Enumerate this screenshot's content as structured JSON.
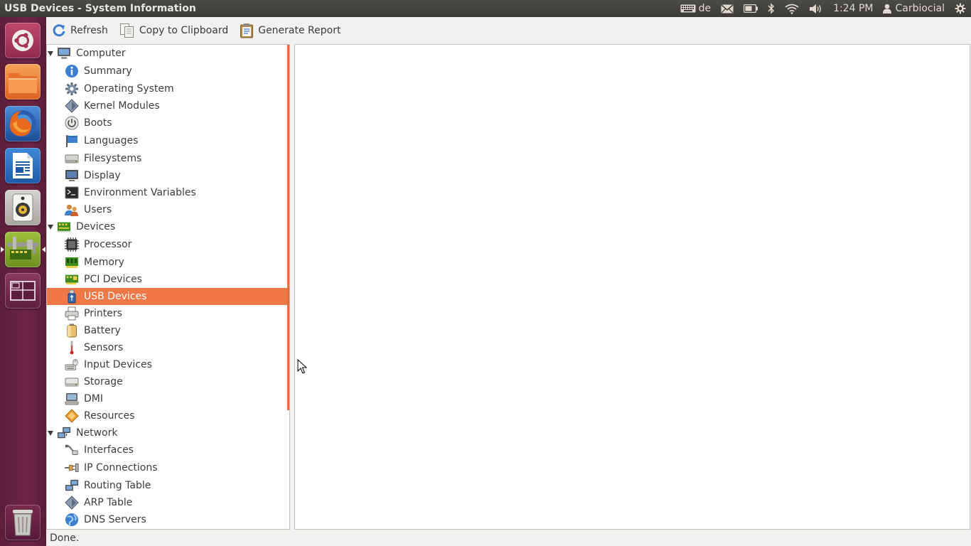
{
  "top_panel": {
    "window_title": "USB Devices - System Information",
    "keyboard_layout": "de",
    "time": "1:24 PM",
    "user": "Carbiocial"
  },
  "launcher": {
    "items": [
      "dash-home",
      "files",
      "firefox",
      "libreoffice-writer",
      "rhythmbox",
      "system-information",
      "workspace-switcher",
      "trash"
    ],
    "active": "system-information"
  },
  "toolbar": {
    "refresh": "Refresh",
    "copy": "Copy to Clipboard",
    "report": "Generate Report"
  },
  "tree": {
    "computer": {
      "label": "Computer",
      "items": [
        "Summary",
        "Operating System",
        "Kernel Modules",
        "Boots",
        "Languages",
        "Filesystems",
        "Display",
        "Environment Variables",
        "Users"
      ]
    },
    "devices": {
      "label": "Devices",
      "items": [
        "Processor",
        "Memory",
        "PCI Devices",
        "USB Devices",
        "Printers",
        "Battery",
        "Sensors",
        "Input Devices",
        "Storage",
        "DMI",
        "Resources"
      ]
    },
    "network": {
      "label": "Network",
      "items": [
        "Interfaces",
        "IP Connections",
        "Routing Table",
        "ARP Table",
        "DNS Servers"
      ]
    },
    "selected": "USB Devices"
  },
  "status": "Done.",
  "colors": {
    "accent": "#f07746",
    "launcher_bg": "#6d2644",
    "panel_bg": "#3c3b37"
  }
}
